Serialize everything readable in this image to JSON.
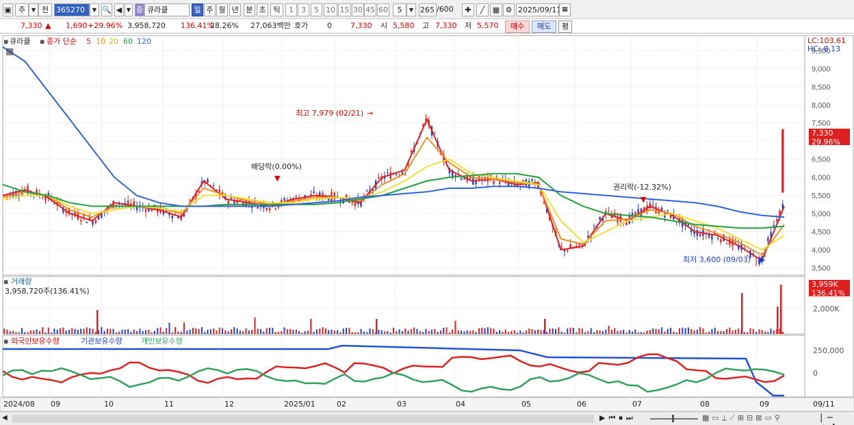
{
  "toolbar": {
    "market": "주",
    "scope": "전",
    "code": "365270",
    "stock_name": "큐라클",
    "stock_prefix": "종",
    "periods": [
      "일",
      "주",
      "월",
      "년",
      "분",
      "초",
      "틱"
    ],
    "selected_period": "일",
    "minutes": [
      "1",
      "3",
      "5",
      "10",
      "15",
      "30",
      "45",
      "60"
    ],
    "interval": "5",
    "count": "265",
    "count_total": "/600",
    "date": "2025/09/11"
  },
  "info": {
    "price": "7,330",
    "change": "1,690",
    "change_rate": "+29.96%",
    "volume": "3,958,720",
    "volume_rate": "136.41%",
    "turnover": "28.26%",
    "amount": "27,063백만",
    "quote_label": "호가",
    "quote_value": "0",
    "quote_price": "7,330",
    "open_label": "시",
    "open": "5,580",
    "high_label": "고",
    "high": "7,330",
    "low_label": "저",
    "low": "5,570",
    "buy": "매수",
    "sell": "매도",
    "avg": "평"
  },
  "price_panel": {
    "name": "큐라클",
    "ma_label": "종가 단순",
    "ma": [
      {
        "period": "5",
        "color": "#e02020"
      },
      {
        "period": "10",
        "color": "#f09020"
      },
      {
        "period": "20",
        "color": "#f0e030"
      },
      {
        "period": "60",
        "color": "#20a040"
      },
      {
        "period": "120",
        "color": "#3060e0"
      }
    ],
    "lc": "LC:103.61",
    "hc": "HC:-8.13",
    "current_price": "7,330",
    "current_rate": "29.96%",
    "annotations": {
      "high": "최고 7,979 (02/21)",
      "dividend": "배당락(0.00%)",
      "rights": "권리락(-12.32%)",
      "low": "최저 3,600 (09/03)"
    }
  },
  "volume_panel": {
    "title": "거래량",
    "value": "3,958,720주(136.41%)",
    "current": "3,959K",
    "current_rate": "136.41%",
    "tick": "2,000K"
  },
  "holdings_panel": {
    "series": [
      "외국인보유수량",
      "기관보유수량",
      "개인보유수량"
    ],
    "colors": [
      "#e02020",
      "#2050e0",
      "#30a060"
    ],
    "ticks": [
      "250,000",
      "0"
    ]
  },
  "x_labels": [
    "2024/08",
    "09",
    "10",
    "11",
    "12",
    "2025/01",
    "02",
    "03",
    "04",
    "05",
    "06",
    "07",
    "08",
    "09",
    "09/11"
  ],
  "chart_data": {
    "type": "candlestick",
    "y_ticks": [
      3500,
      4000,
      4500,
      5000,
      5500,
      6000,
      6500,
      7000,
      7500,
      8000,
      8500,
      9000,
      9500
    ],
    "y_range": [
      3300,
      9800
    ],
    "volume_tick": 2000,
    "holdings_ticks": [
      250000,
      0
    ],
    "x_categories": [
      "2024/08",
      "09",
      "10",
      "11",
      "12",
      "2025/01",
      "02",
      "03",
      "04",
      "05",
      "06",
      "07",
      "08",
      "09",
      "09/11"
    ],
    "series": [
      {
        "name": "5",
        "values": [
          5500,
          5650,
          5450,
          5000,
          4800,
          5300,
          5200,
          5100,
          4900,
          5900,
          5400,
          5300,
          5200,
          5400,
          5500,
          5450,
          5300,
          6000,
          6200,
          7600,
          6200,
          5900,
          5950,
          5800,
          5850,
          4000,
          4100,
          5000,
          4800,
          5200,
          4950,
          4500,
          4400,
          4100,
          3700,
          5200
        ]
      },
      {
        "name": "10",
        "values": [
          5450,
          5600,
          5500,
          5100,
          4900,
          5200,
          5200,
          5150,
          5000,
          5700,
          5500,
          5350,
          5250,
          5350,
          5450,
          5450,
          5350,
          5800,
          6100,
          7100,
          6400,
          6000,
          5950,
          5850,
          5800,
          4300,
          4150,
          4800,
          4850,
          5100,
          5000,
          4650,
          4450,
          4200,
          3850,
          4700
        ]
      },
      {
        "name": "20",
        "values": [
          5400,
          5500,
          5500,
          5200,
          5000,
          5100,
          5200,
          5150,
          5050,
          5500,
          5500,
          5400,
          5300,
          5300,
          5400,
          5450,
          5400,
          5600,
          5900,
          6300,
          6500,
          6100,
          6000,
          5900,
          5800,
          4800,
          4200,
          4500,
          4800,
          4900,
          5000,
          4800,
          4600,
          4300,
          4000,
          4400
        ]
      },
      {
        "name": "60",
        "values": [
          5800,
          5600,
          5500,
          5300,
          5200,
          5200,
          5200,
          5200,
          5200,
          5200,
          5250,
          5250,
          5250,
          5250,
          5250,
          5300,
          5400,
          5500,
          5700,
          5900,
          6000,
          6050,
          6100,
          6100,
          6000,
          5500,
          5200,
          5000,
          4950,
          4900,
          4800,
          4700,
          4650,
          4600,
          4600,
          4650
        ]
      },
      {
        "name": "120",
        "values": [
          9600,
          9200,
          8400,
          7600,
          6800,
          6000,
          5500,
          5300,
          5200,
          5200,
          5200,
          5200,
          5200,
          5250,
          5300,
          5350,
          5450,
          5500,
          5550,
          5600,
          5700,
          5700,
          5750,
          5750,
          5700,
          5600,
          5550,
          5500,
          5450,
          5400,
          5350,
          5300,
          5200,
          5050,
          4950,
          4900
        ]
      }
    ]
  }
}
